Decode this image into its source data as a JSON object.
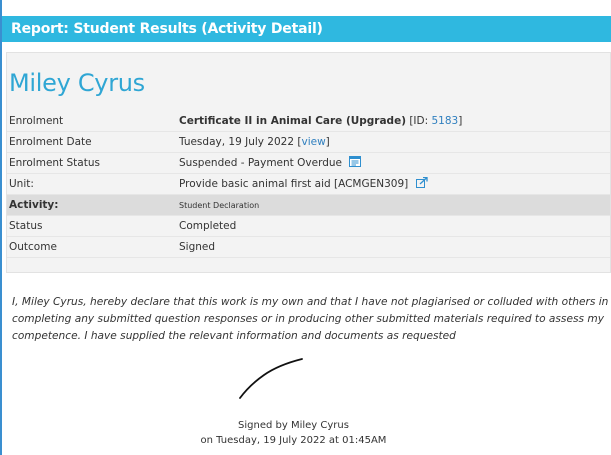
{
  "header": {
    "title": "Report: Student Results (Activity Detail)"
  },
  "student": {
    "name": "Miley Cyrus"
  },
  "details": {
    "enrolment_label": "Enrolment",
    "enrolment_course": "Certificate II in Animal Care (Upgrade)",
    "enrolment_id_prefix": " [ID: ",
    "enrolment_id": "5183",
    "enrolment_id_suffix": "]",
    "enrolment_date_label": "Enrolment Date",
    "enrolment_date": "Tuesday, 19 July 2022",
    "enrolment_date_view_open": " [",
    "enrolment_date_view_link": "view",
    "enrolment_date_view_close": "]",
    "enrolment_status_label": "Enrolment Status",
    "enrolment_status": "Suspended - Payment Overdue",
    "unit_label": "Unit:",
    "unit_value": "Provide basic animal first aid [ACMGEN309]",
    "activity_label": "Activity:",
    "activity_value": "Student Declaration",
    "status_label": "Status",
    "status_value": "Completed",
    "outcome_label": "Outcome",
    "outcome_value": "Signed"
  },
  "declaration": {
    "text": "I, Miley Cyrus, hereby declare that this work is my own and that I have not plagiarised or colluded with others in completing any submitted question responses or in producing other submitted materials required to assess my competence. I have supplied the relevant information and documents as requested"
  },
  "signature": {
    "signed_by": "Signed by Miley Cyrus",
    "signed_on": "on Tuesday, 19 July 2022 at 01:45AM"
  },
  "icons": {
    "status_note": "note-icon",
    "unit_link": "external-link-icon"
  },
  "colors": {
    "header_bg": "#2fb8e0",
    "name_color": "#2fa6d4",
    "link_color": "#2f7fbf"
  }
}
